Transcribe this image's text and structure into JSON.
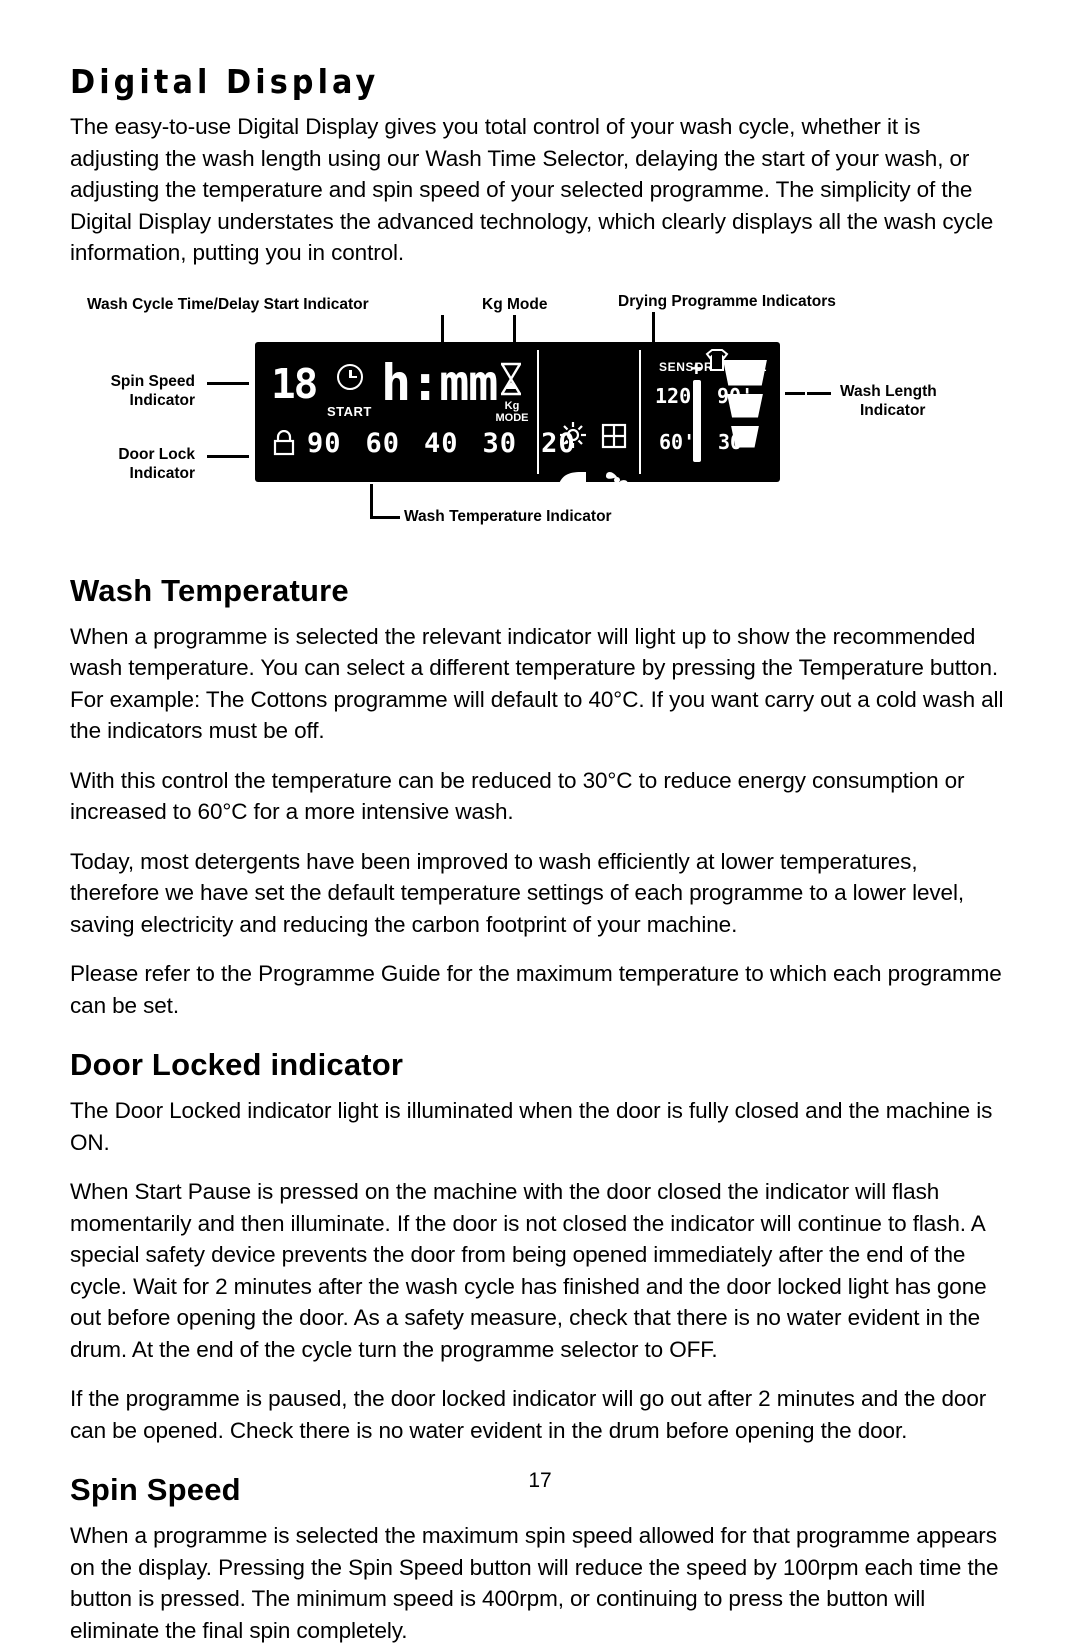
{
  "page": {
    "number": "17"
  },
  "section": {
    "title": "Digital Display",
    "intro": "The easy-to-use Digital Display gives you total control of your wash cycle, whether it is adjusting the wash length using our Wash Time Selector, delaying the start of your wash, or adjusting the temperature and spin speed of your selected programme. The simplicity of the Digital Display understates the advanced technology, which clearly displays all the wash cycle information, putting you in control."
  },
  "diagram": {
    "callouts": {
      "wash_cycle_time": "Wash Cycle Time/Delay Start Indicator",
      "kg_mode": "Kg Mode",
      "drying_programme": "Drying Programme Indicators",
      "spin_speed": "Spin Speed\nIndicator",
      "spin_speed_l1": "Spin Speed",
      "spin_speed_l2": "Indicator",
      "door_lock_l1": "Door Lock",
      "door_lock_l2": "Indicator",
      "wash_length_l1": "Wash Length",
      "wash_length_l2": "Indicator",
      "wash_temperature": "Wash Temperature Indicator"
    },
    "panel": {
      "spin_value": "18",
      "start_label": "START",
      "time_display": "h:mm",
      "kg_label_1": "Kg",
      "kg_label_2": "MODE",
      "spin_speeds": [
        "90",
        "60",
        "40",
        "30",
        "20"
      ],
      "sensor_label": "SENSOR",
      "time_label": "TIME",
      "dry_times_top": [
        "120'",
        "90'"
      ],
      "dry_times_bottom": [
        "60'",
        "30'"
      ],
      "plus_label": "+"
    }
  },
  "wash_temperature": {
    "heading": "Wash Temperature",
    "paragraphs": [
      "When a programme is selected the relevant indicator will light up to show the recommended wash temperature. You can select a different temperature by pressing the Temperature button. For example: The Cottons programme will default to 40°C. If you want carry out a cold wash all the indicators must be off.",
      "With this control the temperature can be reduced to 30°C to reduce energy consumption or increased to 60°C for a more intensive wash.",
      "Today, most detergents have been improved to wash efficiently at lower temperatures, therefore we have set the default temperature settings of each programme to a lower level, saving electricity and reducing the carbon footprint of your machine.",
      "Please refer to the Programme Guide for the maximum temperature to which each programme can be set."
    ]
  },
  "door_locked": {
    "heading": "Door Locked indicator",
    "paragraphs": [
      "The Door Locked indicator light is illuminated when the door is fully closed and the machine is ON.",
      "When Start Pause is pressed on the machine with the door closed the indicator will flash momentarily and then illuminate. If the door is not closed the indicator will continue to flash. A special safety device prevents the door from being opened immediately after the end of the cycle. Wait for 2 minutes after the wash cycle has finished and the door locked light has gone out before opening the door. As a safety measure, check that there is no water evident in the drum. At the end of the cycle turn the programme selector to OFF.",
      "If the programme is paused, the door locked indicator will go out after 2 minutes and the door can be opened. Check there is no water evident in the drum before opening the door."
    ]
  },
  "spin_speed": {
    "heading": "Spin Speed",
    "paragraphs": [
      "When a programme is selected the maximum spin speed allowed for that programme appears on the display. Pressing the Spin Speed button will reduce the speed by 100rpm each time the button is pressed. The minimum speed is 400rpm, or continuing to press the button will eliminate the final spin completely."
    ]
  }
}
